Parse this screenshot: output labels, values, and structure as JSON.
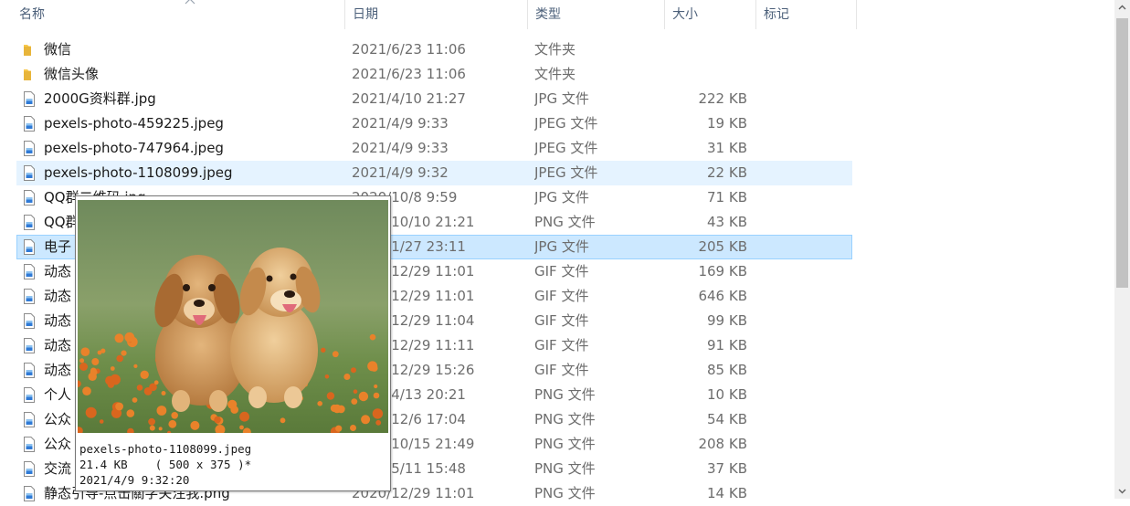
{
  "columns": {
    "name": "名称",
    "date": "日期",
    "type": "类型",
    "size": "大小",
    "tags": "标记"
  },
  "rows": [
    {
      "name": "微信",
      "date": "2021/6/23 11:06",
      "type": "文件夹",
      "size": "",
      "icon": "folder-icon"
    },
    {
      "name": "微信头像",
      "date": "2021/6/23 11:06",
      "type": "文件夹",
      "size": "",
      "icon": "folder-icon"
    },
    {
      "name": "2000G资料群.jpg",
      "date": "2021/4/10 21:27",
      "type": "JPG 文件",
      "size": "222 KB",
      "icon": "image-file-icon"
    },
    {
      "name": "pexels-photo-459225.jpeg",
      "date": "2021/4/9 9:33",
      "type": "JPEG 文件",
      "size": "19 KB",
      "icon": "image-file-icon"
    },
    {
      "name": "pexels-photo-747964.jpeg",
      "date": "2021/4/9 9:33",
      "type": "JPEG 文件",
      "size": "31 KB",
      "icon": "image-file-icon"
    },
    {
      "name": "pexels-photo-1108099.jpeg",
      "date": "2021/4/9 9:32",
      "type": "JPEG 文件",
      "size": "22 KB",
      "icon": "image-file-icon",
      "state": "hover"
    },
    {
      "name": "QQ群二维码.jpg",
      "date": "2020/10/8 9:59",
      "type": "JPG 文件",
      "size": "71 KB",
      "icon": "image-file-icon"
    },
    {
      "name": "QQ群",
      "date": "2020/10/10 21:21",
      "type": "PNG 文件",
      "size": "43 KB",
      "icon": "image-file-icon"
    },
    {
      "name": "电子",
      "date": "2020/1/27 23:11",
      "type": "JPG 文件",
      "size": "205 KB",
      "icon": "image-file-icon",
      "state": "selected"
    },
    {
      "name": "动态",
      "date": "2020/12/29 11:01",
      "type": "GIF 文件",
      "size": "169 KB",
      "icon": "image-file-icon"
    },
    {
      "name": "动态",
      "date": "2020/12/29 11:01",
      "type": "GIF 文件",
      "size": "646 KB",
      "icon": "image-file-icon"
    },
    {
      "name": "动态",
      "date": "2020/12/29 11:04",
      "type": "GIF 文件",
      "size": "99 KB",
      "icon": "image-file-icon"
    },
    {
      "name": "动态",
      "date": "2020/12/29 11:11",
      "type": "GIF 文件",
      "size": "91 KB",
      "icon": "image-file-icon"
    },
    {
      "name": "动态",
      "date": "2020/12/29 15:26",
      "type": "GIF 文件",
      "size": "85 KB",
      "icon": "image-file-icon"
    },
    {
      "name": "个人",
      "date": "2021/4/13 20:21",
      "type": "PNG 文件",
      "size": "10 KB",
      "icon": "image-file-icon"
    },
    {
      "name": "公众",
      "date": "2020/12/6 17:04",
      "type": "PNG 文件",
      "size": "54 KB",
      "icon": "image-file-icon"
    },
    {
      "name": "公众",
      "date": "2020/10/15 21:49",
      "type": "PNG 文件",
      "size": "208 KB",
      "icon": "image-file-icon"
    },
    {
      "name": "交流",
      "date": "2020/5/11 15:48",
      "type": "PNG 文件",
      "size": "37 KB",
      "icon": "image-file-icon"
    },
    {
      "name": "静态引导-点击關字关注我.png",
      "date": "2020/12/29 11:01",
      "type": "PNG 文件",
      "size": "14 KB",
      "icon": "image-file-icon"
    }
  ],
  "tooltip": {
    "filename": "pexels-photo-1108099.jpeg",
    "size_line": "21.4 KB    ( 500 x 375 )*",
    "date_line": "2021/4/9 9:32:20",
    "thumbnail": "two-puppies-in-flower-field"
  },
  "colors": {
    "hover": "#e5f3ff",
    "selected": "#cce8ff",
    "folder": "#f8c84a"
  }
}
